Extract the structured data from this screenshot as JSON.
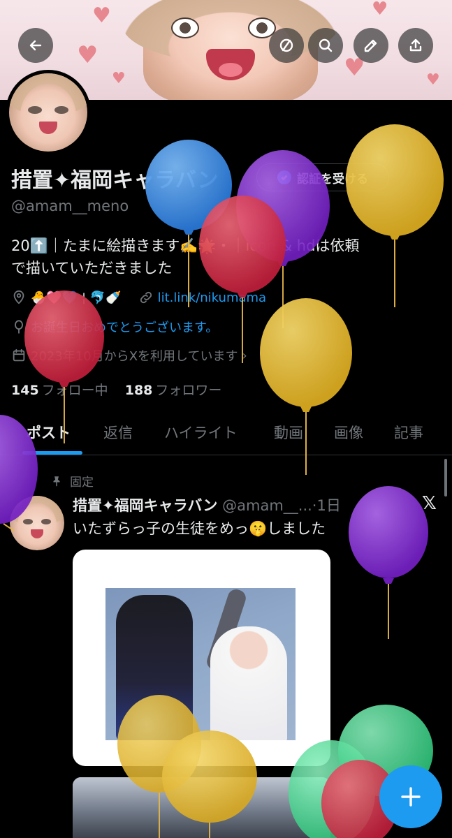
{
  "profile": {
    "display_name": "措置✦福岡キャラバン",
    "handle": "@amam__meno",
    "verify_label": "認証を受ける",
    "bio_line1": "20⬆️｜たまに絵描きます✍️🌟・｜icon & hdは依頼",
    "bio_line2": "で描いていただきました",
    "location": "🐣🩷💙 ¦ 🐬🍼",
    "website": "lit.link/nikumama",
    "birthday": "お誕生日おめでとうございます。",
    "joined": "2023年10月からXを利用しています",
    "following_count": "145",
    "following_label": "フォロー中",
    "followers_count": "188",
    "followers_label": "フォロワー"
  },
  "tabs": [
    "ポスト",
    "返信",
    "ハイライト",
    "動画",
    "画像",
    "記事"
  ],
  "post": {
    "pinned_label": "固定",
    "author": "措置✦福岡キャラバン",
    "meta": "@amam__...·1日",
    "text": "いたずらっ子の生徒をめっ🤫しました",
    "x_logo": "𝕏"
  },
  "icons": {
    "back": "arrow-left-icon",
    "ban": "circle-slash-icon",
    "search": "search-icon",
    "edit": "pencil-icon",
    "share": "share-upload-icon",
    "compose": "plus-icon"
  },
  "colors": {
    "accent": "#1d9bf0",
    "balloon_blue": "#3a8fe0",
    "balloon_purple": "#8a2fd6",
    "balloon_red": "#d22a45",
    "balloon_yellow": "#e0b52a",
    "balloon_green": "#3ed28a"
  }
}
